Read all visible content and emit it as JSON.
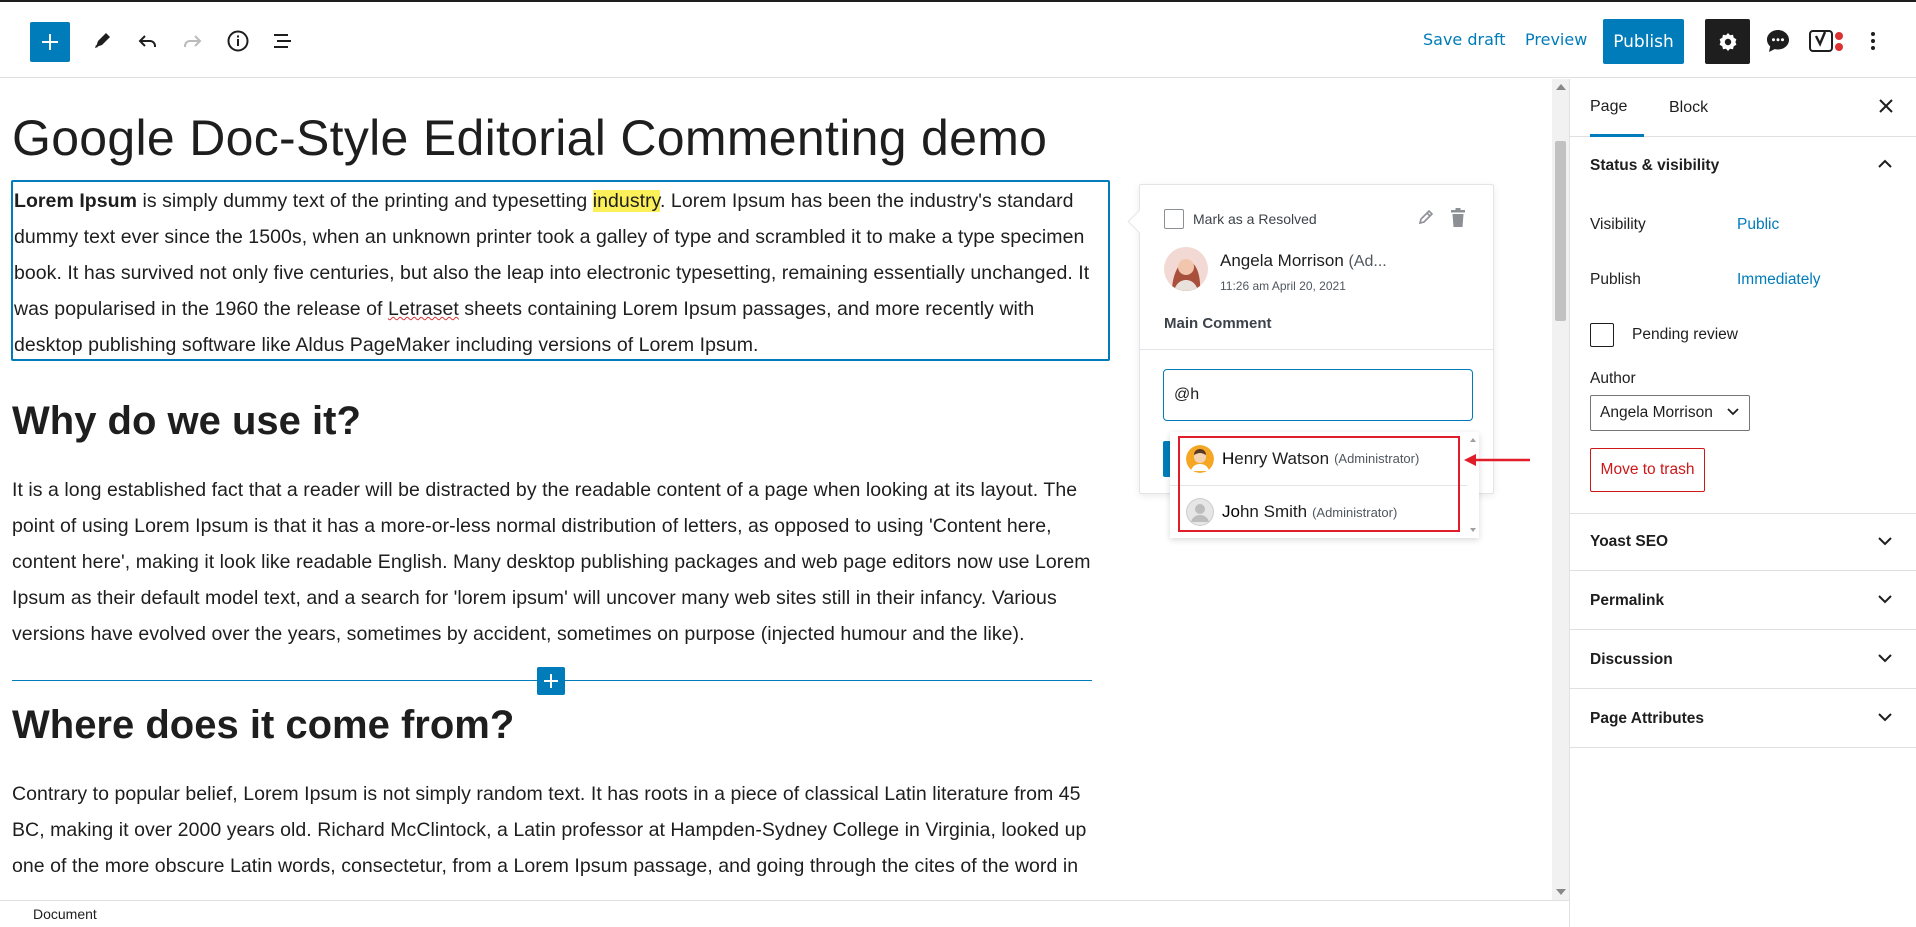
{
  "toolbar": {
    "add_block_icon": "plus-icon",
    "tools_icon": "pencil-icon",
    "undo_icon": "undo-icon",
    "redo_icon": "redo-icon",
    "details_icon": "info-icon",
    "outline_icon": "list-view-icon",
    "save_draft": "Save draft",
    "preview": "Preview",
    "publish": "Publish",
    "settings_icon": "gear-icon",
    "comments_icon": "comment-bubble-icon",
    "yoast_icon": "yoast-icon",
    "options_icon": "more-vertical-icon"
  },
  "post": {
    "title": "Google Doc-Style Editorial Commenting demo",
    "intro": {
      "bold": "Lorem Ipsum",
      "before_highlight": " is simply dummy text of the printing and typesetting ",
      "highlight": "industry",
      "after_highlight": ". Lorem Ipsum has been the industry's standard dummy text ever since the 1500s, when an unknown printer took a galley of type and scrambled it to make a type specimen book. It has survived not only five centuries, but also the leap into electronic typesetting, remaining essentially unchanged. It was popularised in the 1960 the release of ",
      "misspelled": "Letraset",
      "after_misspelled": " sheets containing Lorem Ipsum passages, and more recently with desktop publishing software like Aldus PageMaker including versions of Lorem Ipsum."
    },
    "heading_1": "Why do we use it?",
    "paragraph_1": "It is a long established fact that a reader will be distracted by the readable content of a page when looking at its layout. The point of using Lorem Ipsum is that it has a more-or-less normal distribution of letters, as opposed to using 'Content here, content here', making it look like readable English. Many desktop publishing packages and web page editors now use Lorem Ipsum as their default model text, and a search for 'lorem ipsum' will uncover many web sites still in their infancy. Various versions have evolved over the years, sometimes by accident, sometimes on purpose (injected humour and the like).",
    "heading_2": "Where does it come from?",
    "paragraph_2": "Contrary to popular belief, Lorem Ipsum is not simply random text. It has roots in a piece of classical Latin literature from 45 BC, making it over 2000 years old. Richard McClintock, a Latin professor at Hampden-Sydney College in Virginia, looked up one of the more obscure Latin words, consectetur, from a Lorem Ipsum passage, and going through the cites of the word in"
  },
  "comment": {
    "resolve_label": "Mark as a Resolved",
    "edit_icon": "pencil-icon",
    "delete_icon": "trash-icon",
    "author": "Angela Morrison",
    "author_role_truncated": "(Ad...",
    "date": "11:26 am April 20, 2021",
    "text": "Main Comment",
    "reply_value": "@h"
  },
  "mentions": [
    {
      "initial": "H",
      "rest": "enry Watson",
      "role": "(Administrator)"
    },
    {
      "initial": "Jo",
      "rest": "hn Smith",
      "role": "(Administrator)",
      "pre": "",
      "note": ""
    }
  ],
  "sidebar": {
    "tabs": [
      "Page",
      "Block"
    ],
    "status_visibility": "Status & visibility",
    "visibility_label": "Visibility",
    "visibility_value": "Public",
    "publish_label": "Publish",
    "publish_value": "Immediately",
    "pending_review": "Pending review",
    "author_label": "Author",
    "author_value": "Angela Morrison",
    "move_to_trash": "Move to trash",
    "panels": [
      "Yoast SEO",
      "Permalink",
      "Discussion",
      "Page Attributes"
    ]
  },
  "footer": {
    "breadcrumb": "Document"
  },
  "colors": {
    "accent": "#007cba",
    "highlight": "#fcf05a",
    "danger": "#cc1818",
    "annotation": "#e11d2a"
  }
}
